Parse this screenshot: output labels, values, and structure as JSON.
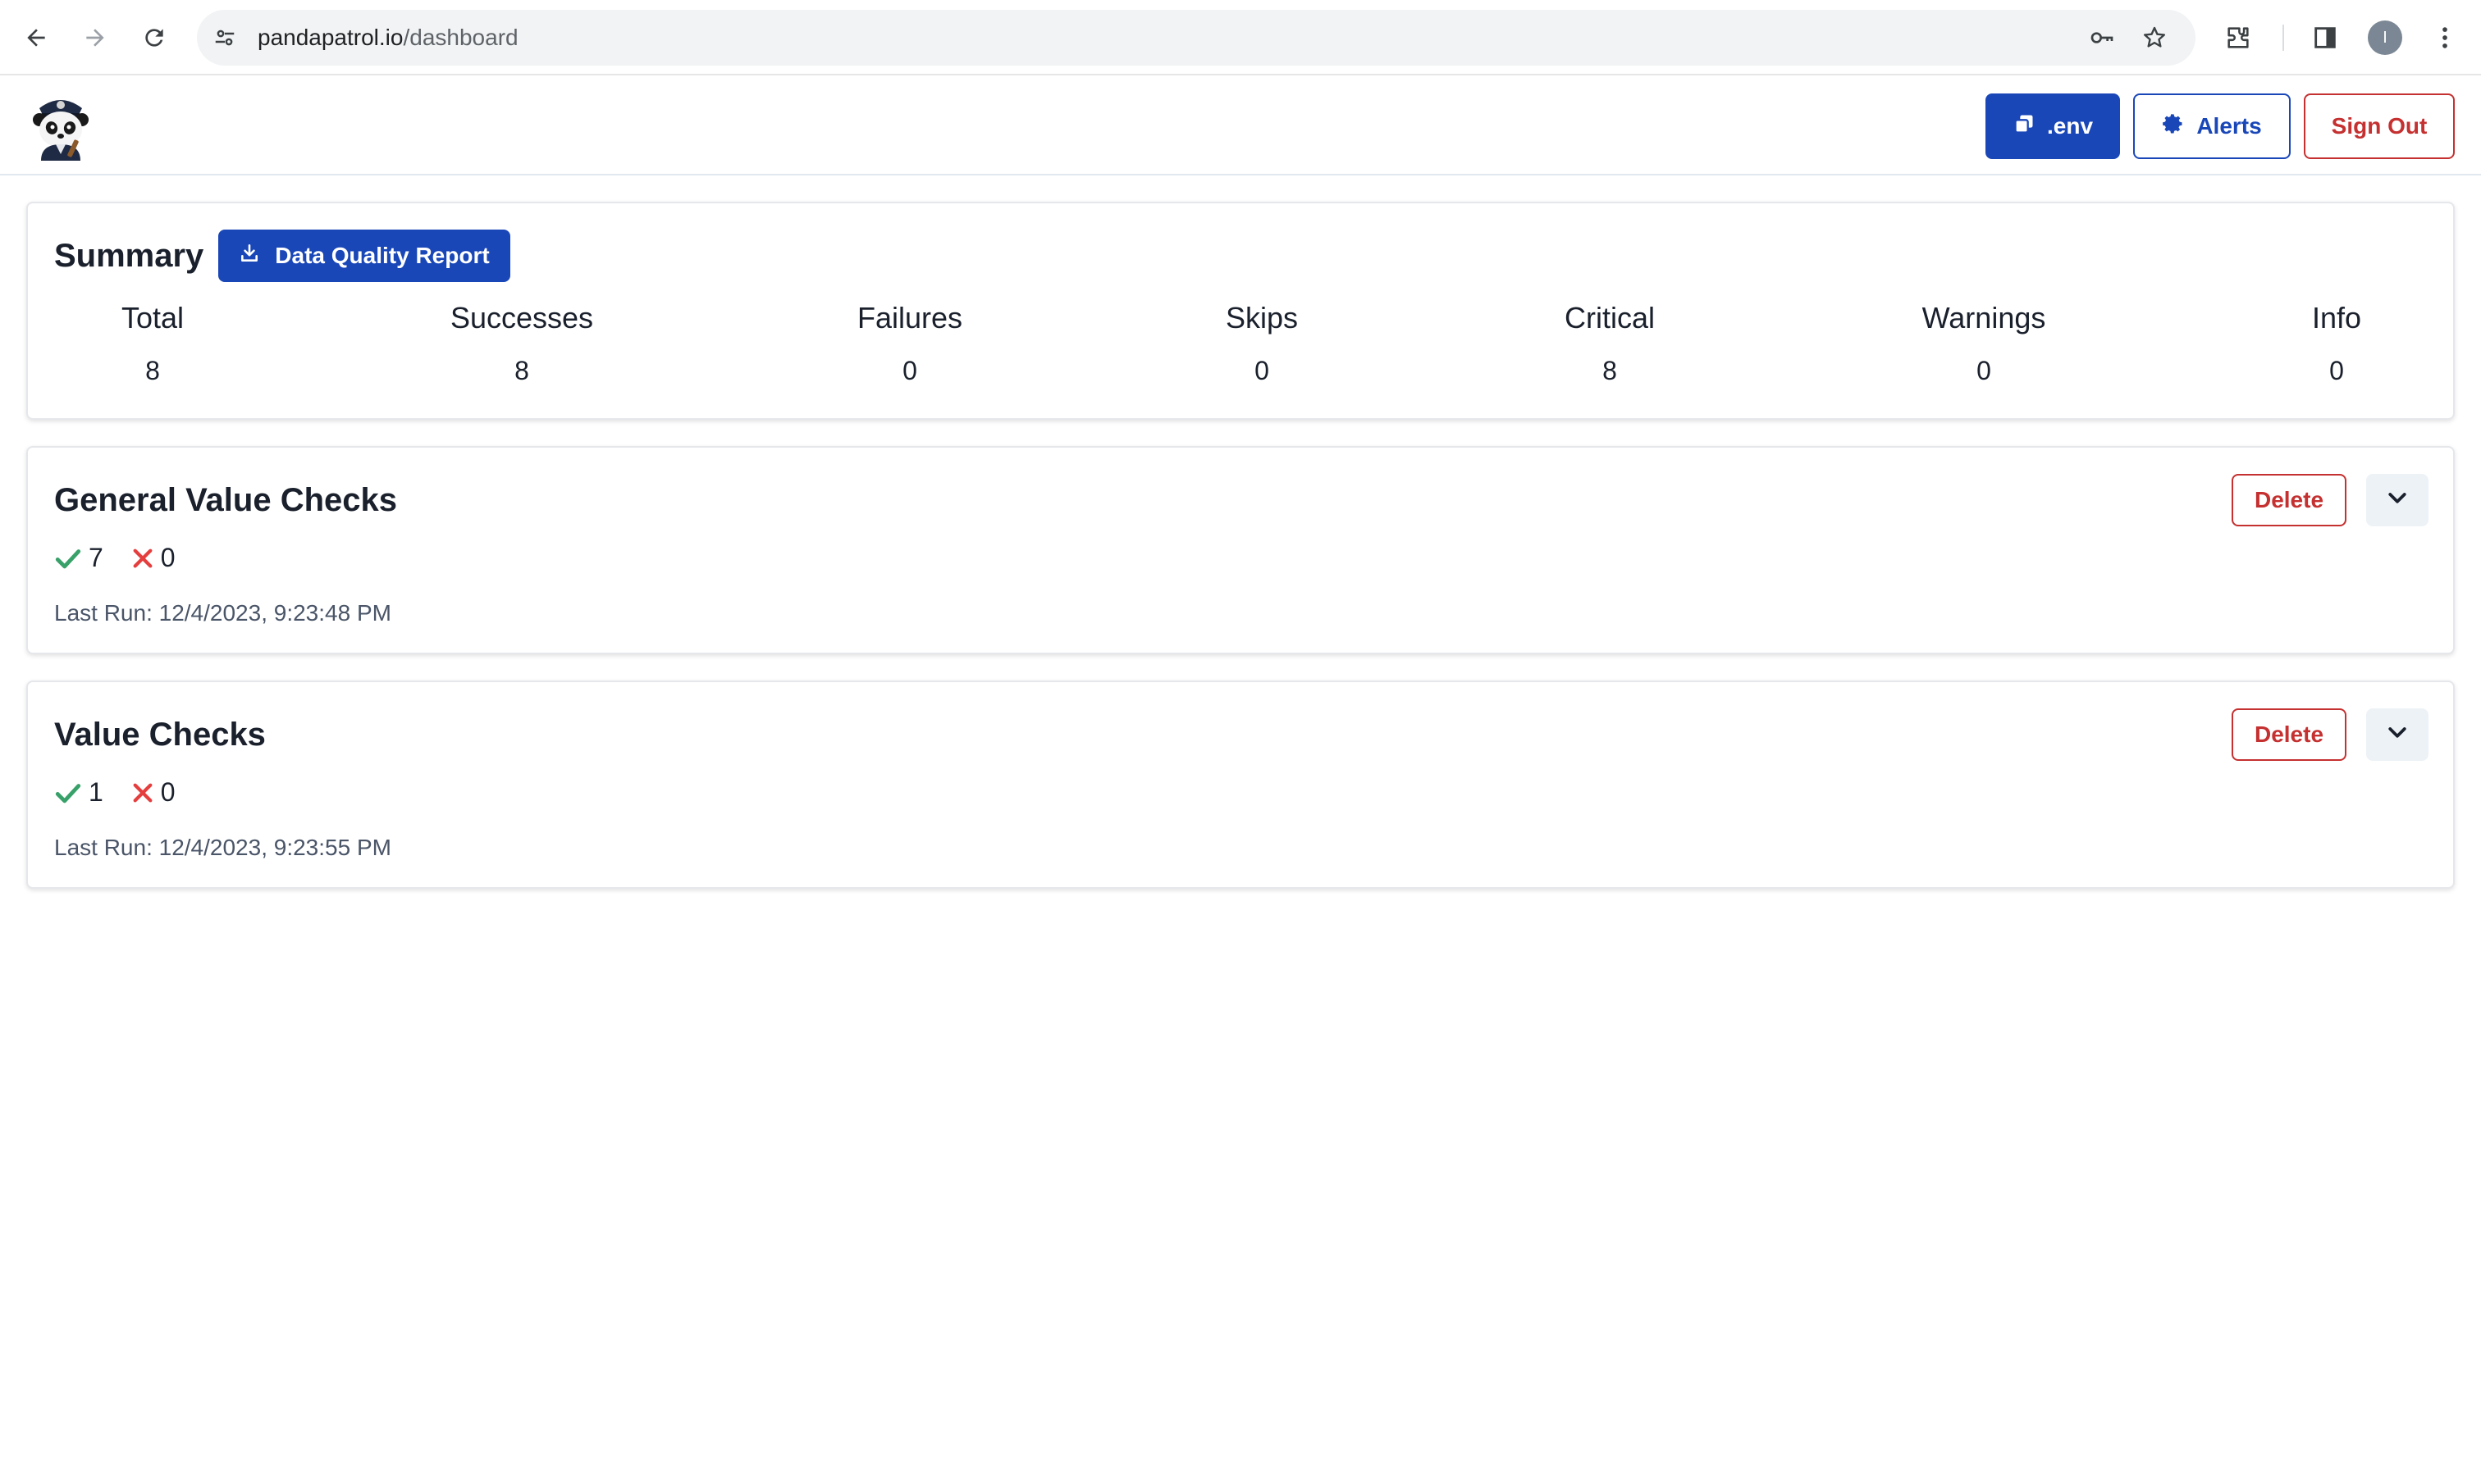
{
  "browser": {
    "url_host": "pandapatrol.io",
    "url_path": "/dashboard",
    "profile_initial": "I"
  },
  "header": {
    "logo_alt": "panda-police-logo",
    "env_label": ".env",
    "alerts_label": "Alerts",
    "signout_label": "Sign Out"
  },
  "summary": {
    "title": "Summary",
    "report_button": "Data Quality Report",
    "stats": [
      {
        "label": "Total",
        "value": "8"
      },
      {
        "label": "Successes",
        "value": "8"
      },
      {
        "label": "Failures",
        "value": "0"
      },
      {
        "label": "Skips",
        "value": "0"
      },
      {
        "label": "Critical",
        "value": "8"
      },
      {
        "label": "Warnings",
        "value": "0"
      },
      {
        "label": "Info",
        "value": "0"
      }
    ]
  },
  "checks": [
    {
      "title": "General Value Checks",
      "successes": "7",
      "failures": "0",
      "last_run": "Last Run: 12/4/2023, 9:23:48 PM",
      "delete_label": "Delete"
    },
    {
      "title": "Value Checks",
      "successes": "1",
      "failures": "0",
      "last_run": "Last Run: 12/4/2023, 9:23:55 PM",
      "delete_label": "Delete"
    }
  ],
  "colors": {
    "primary": "#1a47b8",
    "danger": "#c53030",
    "success": "#38a169"
  }
}
